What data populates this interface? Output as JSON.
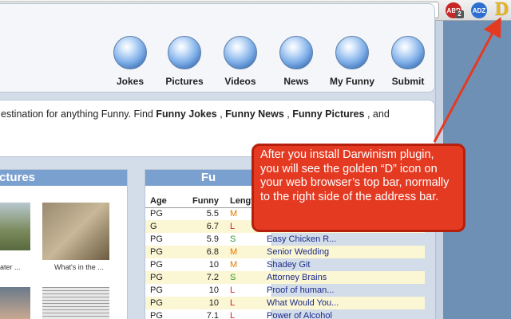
{
  "toolbar": {
    "ext_abp": "ABP",
    "ext_abp_badge": "2",
    "ext_adz": "ADZ",
    "ext_darwinism": "D"
  },
  "nav": {
    "items": [
      {
        "label": "Jokes"
      },
      {
        "label": "Pictures"
      },
      {
        "label": "Videos"
      },
      {
        "label": "News"
      },
      {
        "label": "My Funny"
      },
      {
        "label": "Submit"
      }
    ]
  },
  "intro": {
    "text_start": "estination for anything Funny. Find ",
    "link1": "Funny Jokes",
    "sep1": " , ",
    "link2": "Funny News",
    "sep2": " , ",
    "link3": "Funny Pictures",
    "text_end": " , and"
  },
  "pictures": {
    "header": "ctures",
    "captions": [
      "ater ...",
      "What's in the ..."
    ]
  },
  "funny": {
    "header": "Fu",
    "columns": [
      "Age",
      "Funny",
      "Length"
    ],
    "rows": [
      {
        "age": "PG",
        "funny": "5.5",
        "length": "M",
        "title": ""
      },
      {
        "age": "G",
        "funny": "6.7",
        "length": "L",
        "title": ""
      },
      {
        "age": "PG",
        "funny": "5.9",
        "length": "S",
        "title": "Easy Chicken R..."
      },
      {
        "age": "PG",
        "funny": "6.8",
        "length": "M",
        "title": "Senior Wedding"
      },
      {
        "age": "PG",
        "funny": "10",
        "length": "M",
        "title": "Shadey Git"
      },
      {
        "age": "PG",
        "funny": "7.2",
        "length": "S",
        "title": "Attorney Brains"
      },
      {
        "age": "PG",
        "funny": "10",
        "length": "L",
        "title": "Proof of human..."
      },
      {
        "age": "PG",
        "funny": "10",
        "length": "L",
        "title": "What Would You..."
      },
      {
        "age": "PG",
        "funny": "7.1",
        "length": "L",
        "title": "Power of Alcohol"
      }
    ]
  },
  "callout": {
    "text": "After you install Darwinism plugin, you will see the golden “D” icon on your web browser’s top bar, normally to the right side of the address bar."
  }
}
